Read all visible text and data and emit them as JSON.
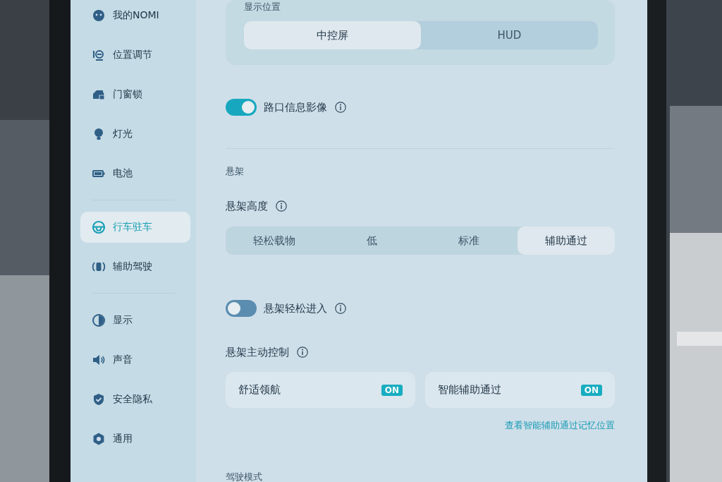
{
  "sidebar": {
    "sections": [
      {
        "items": [
          {
            "label": "我的NOMI",
            "selected": false
          },
          {
            "label": "位置调节",
            "selected": false
          },
          {
            "label": "门窗锁",
            "selected": false
          },
          {
            "label": "灯光",
            "selected": false
          },
          {
            "label": "电池",
            "selected": false
          }
        ]
      },
      {
        "items": [
          {
            "label": "行车驻车",
            "selected": true
          },
          {
            "label": "辅助驾驶",
            "selected": false
          }
        ]
      },
      {
        "items": [
          {
            "label": "显示",
            "selected": false
          },
          {
            "label": "声音",
            "selected": false
          },
          {
            "label": "安全隐私",
            "selected": false
          },
          {
            "label": "通用",
            "selected": false
          }
        ]
      }
    ]
  },
  "content": [
    {
      "kind": "segmented_card",
      "label": "显示位置",
      "options": [
        {
          "label": "中控屏",
          "selected": true
        },
        {
          "label": "HUD",
          "selected": false
        }
      ]
    },
    {
      "kind": "toggle",
      "label": "路口信息影像",
      "on": true,
      "info": true
    },
    {
      "kind": "divider"
    },
    {
      "kind": "section_header",
      "label": "悬架"
    },
    {
      "kind": "label",
      "label": "悬架高度",
      "info": true
    },
    {
      "kind": "segmented",
      "options": [
        {
          "label": "轻松载物",
          "selected": false
        },
        {
          "label": "低",
          "selected": false
        },
        {
          "label": "标准",
          "selected": false
        },
        {
          "label": "辅助通过",
          "selected": true
        }
      ]
    },
    {
      "kind": "toggle",
      "label": "悬架轻松进入",
      "on": false,
      "info": true
    },
    {
      "kind": "label",
      "label": "悬架主动控制",
      "info": true
    },
    {
      "kind": "cards",
      "items": [
        {
          "label": "舒适领航",
          "badge": "ON",
          "on": true
        },
        {
          "label": "智能辅助通过",
          "badge": "ON",
          "on": true
        }
      ]
    },
    {
      "kind": "link",
      "label": "查看智能辅助通过记忆位置"
    },
    {
      "kind": "section_header",
      "label": "驾驶模式"
    }
  ]
}
